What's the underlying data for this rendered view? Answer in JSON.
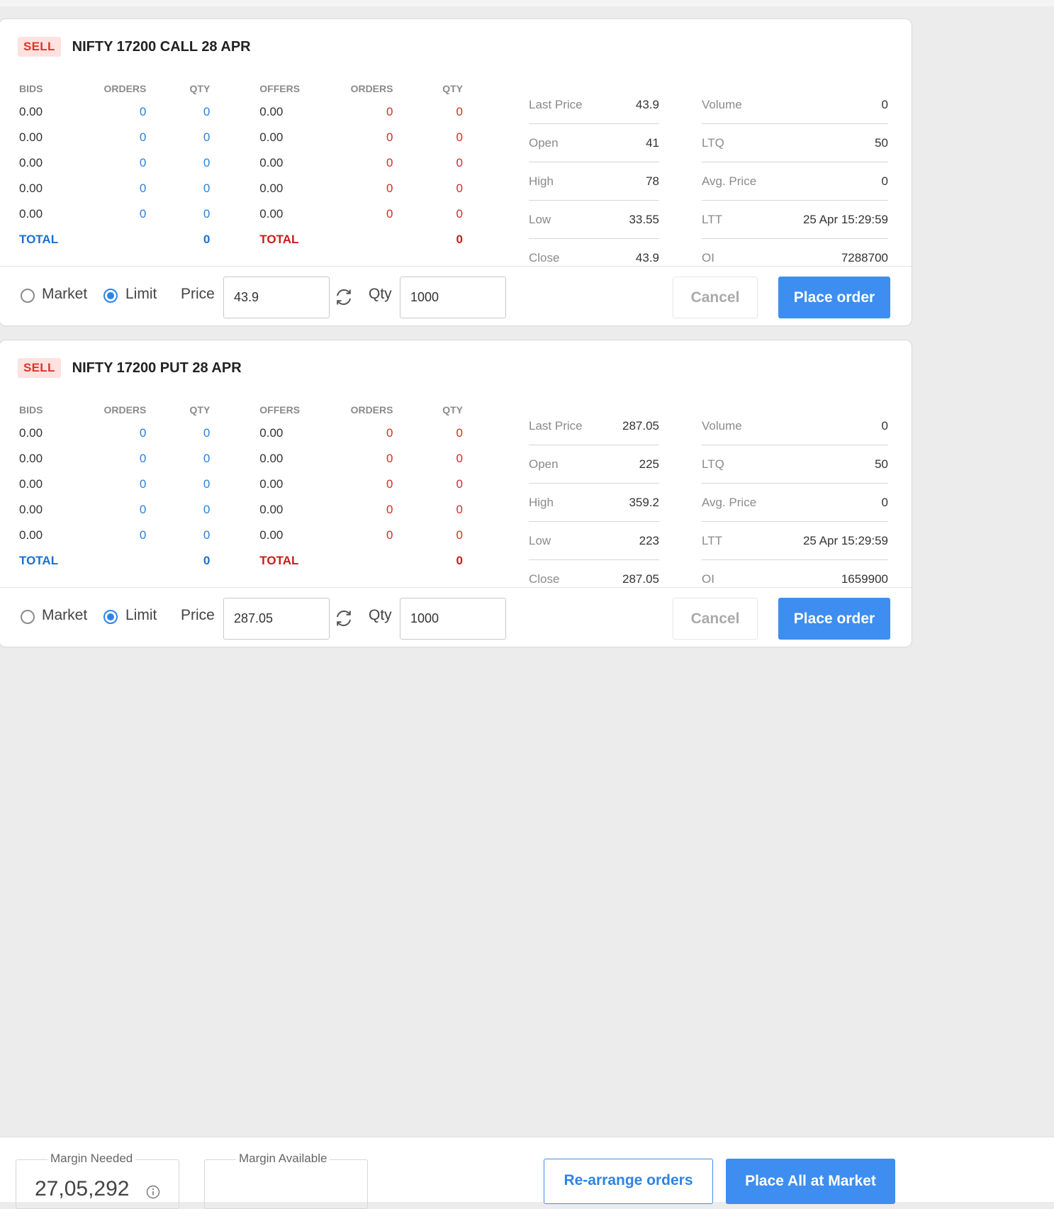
{
  "depth_headers": [
    "BIDS",
    "ORDERS",
    "QTY",
    "OFFERS",
    "ORDERS",
    "QTY"
  ],
  "total_label": "TOTAL",
  "order_form": {
    "market_label": "Market",
    "limit_label": "Limit",
    "price_label": "Price",
    "qty_label": "Qty",
    "cancel_label": "Cancel",
    "place_label": "Place order"
  },
  "orders": [
    {
      "side": "SELL",
      "instrument": "NIFTY 17200 CALL 28 APR",
      "depth_rows": [
        {
          "bid": "0.00",
          "bid_orders": "0",
          "bid_qty": "0",
          "offer": "0.00",
          "offer_orders": "0",
          "offer_qty": "0"
        },
        {
          "bid": "0.00",
          "bid_orders": "0",
          "bid_qty": "0",
          "offer": "0.00",
          "offer_orders": "0",
          "offer_qty": "0"
        },
        {
          "bid": "0.00",
          "bid_orders": "0",
          "bid_qty": "0",
          "offer": "0.00",
          "offer_orders": "0",
          "offer_qty": "0"
        },
        {
          "bid": "0.00",
          "bid_orders": "0",
          "bid_qty": "0",
          "offer": "0.00",
          "offer_orders": "0",
          "offer_qty": "0"
        },
        {
          "bid": "0.00",
          "bid_orders": "0",
          "bid_qty": "0",
          "offer": "0.00",
          "offer_orders": "0",
          "offer_qty": "0"
        }
      ],
      "total_bid_qty": "0",
      "total_offer_qty": "0",
      "stats_left": [
        {
          "label": "Last Price",
          "value": "43.9"
        },
        {
          "label": "Open",
          "value": "41"
        },
        {
          "label": "High",
          "value": "78"
        },
        {
          "label": "Low",
          "value": "33.55"
        },
        {
          "label": "Close",
          "value": "43.9"
        }
      ],
      "stats_right": [
        {
          "label": "Volume",
          "value": "0"
        },
        {
          "label": "LTQ",
          "value": "50"
        },
        {
          "label": "Avg. Price",
          "value": "0"
        },
        {
          "label": "LTT",
          "value": "25 Apr 15:29:59"
        },
        {
          "label": "OI",
          "value": "7288700"
        }
      ],
      "order_type": "Limit",
      "price": "43.9",
      "qty": "1000"
    },
    {
      "side": "SELL",
      "instrument": "NIFTY 17200 PUT 28 APR",
      "depth_rows": [
        {
          "bid": "0.00",
          "bid_orders": "0",
          "bid_qty": "0",
          "offer": "0.00",
          "offer_orders": "0",
          "offer_qty": "0"
        },
        {
          "bid": "0.00",
          "bid_orders": "0",
          "bid_qty": "0",
          "offer": "0.00",
          "offer_orders": "0",
          "offer_qty": "0"
        },
        {
          "bid": "0.00",
          "bid_orders": "0",
          "bid_qty": "0",
          "offer": "0.00",
          "offer_orders": "0",
          "offer_qty": "0"
        },
        {
          "bid": "0.00",
          "bid_orders": "0",
          "bid_qty": "0",
          "offer": "0.00",
          "offer_orders": "0",
          "offer_qty": "0"
        },
        {
          "bid": "0.00",
          "bid_orders": "0",
          "bid_qty": "0",
          "offer": "0.00",
          "offer_orders": "0",
          "offer_qty": "0"
        }
      ],
      "total_bid_qty": "0",
      "total_offer_qty": "0",
      "stats_left": [
        {
          "label": "Last Price",
          "value": "287.05"
        },
        {
          "label": "Open",
          "value": "225"
        },
        {
          "label": "High",
          "value": "359.2"
        },
        {
          "label": "Low",
          "value": "223"
        },
        {
          "label": "Close",
          "value": "287.05"
        }
      ],
      "stats_right": [
        {
          "label": "Volume",
          "value": "0"
        },
        {
          "label": "LTQ",
          "value": "50"
        },
        {
          "label": "Avg. Price",
          "value": "0"
        },
        {
          "label": "LTT",
          "value": "25 Apr 15:29:59"
        },
        {
          "label": "OI",
          "value": "1659900"
        }
      ],
      "order_type": "Limit",
      "price": "287.05",
      "qty": "1000"
    }
  ],
  "footer": {
    "margin_needed_label": "Margin Needed",
    "margin_needed_value": "27,05,292",
    "margin_available_label": "Margin Available",
    "margin_available_value": "",
    "rearrange_label": "Re-arrange orders",
    "place_all_label": "Place All at Market"
  },
  "colors": {
    "accent": "#3d8ef0",
    "bid_blue": "#2d7fd8",
    "offer_red": "#e0281f",
    "sell_badge_bg": "#fde2e0",
    "sell_badge_text": "#d9372b",
    "page_bg": "#ececec"
  },
  "icons": [
    "refresh-icon",
    "info-icon"
  ]
}
